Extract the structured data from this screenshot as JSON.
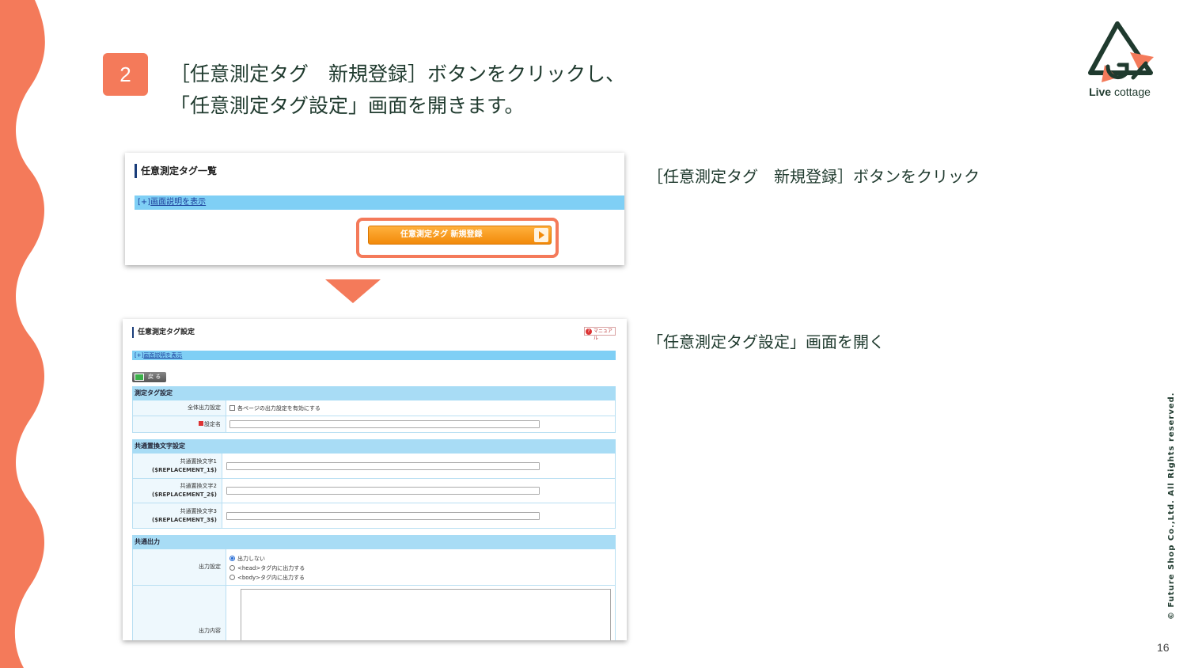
{
  "slide": {
    "step_number": "2",
    "headline_line1": "［任意測定タグ　新規登録］ボタンをクリックし、",
    "headline_line2": "「任意測定タグ設定」画面を開きます。",
    "page_number": "16",
    "copyright": "© Future Shop Co.,Ltd. All Rights reserved.",
    "accent_color": "#f47a5a",
    "text_color": "#1f3a2e"
  },
  "logo": {
    "icon": "live-cottage-house-logo",
    "text_bold": "Live",
    "text_rest": " cottage"
  },
  "captions": {
    "first": "［任意測定タグ　新規登録］ボタンをクリック",
    "second": "「任意測定タグ設定」画面を開く"
  },
  "screen1": {
    "title": "任意測定タグ一覧",
    "info_prefix": "[+]",
    "info_link": "画面説明を表示",
    "new_button_label": "任意測定タグ  新規登録",
    "highlight_color": "#f47a5a"
  },
  "screen2": {
    "title": "任意測定タグ設定",
    "manual_label": "マニュアル",
    "info_prefix": "[+]",
    "info_link": "画面説明を表示",
    "back_label": "戻 る",
    "section_measure": "測定タグ設定",
    "global_output_label": "全体出力設定",
    "global_output_checkbox": "各ページの出力設定を有効にする",
    "setting_name_label": "設定名",
    "section_replace": "共通置換文字設定",
    "replacements": [
      {
        "label": "共通置換文字1",
        "code": "($REPLACEMENT_1$)"
      },
      {
        "label": "共通置換文字2",
        "code": "($REPLACEMENT_2$)"
      },
      {
        "label": "共通置換文字3",
        "code": "($REPLACEMENT_3$)"
      }
    ],
    "section_output": "共通出力",
    "output_setting_label": "出力設定",
    "output_options": [
      "出力しない",
      "<head>タグ内に出力する",
      "<body>タグ内に出力する"
    ],
    "output_selected_index": 0,
    "output_content_label": "出力内容"
  }
}
